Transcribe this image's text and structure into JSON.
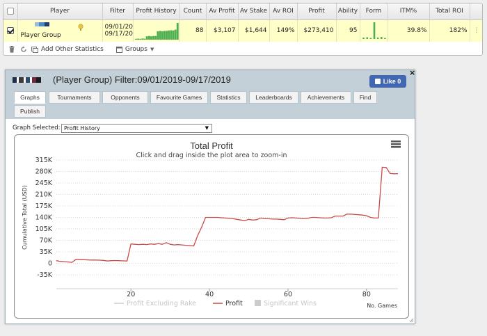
{
  "grid": {
    "headers": [
      "Player",
      "Filter",
      "Profit History",
      "Count",
      "Av Profit",
      "Av Stake",
      "Av ROI",
      "Profit",
      "Ability",
      "Form",
      "ITM%",
      "Total ROI"
    ],
    "row": {
      "checked": true,
      "player": "Player Group",
      "filter_line1": "09/01/20",
      "filter_line2": "09/17/20",
      "count": "88",
      "av_profit": "$3,107",
      "av_stake": "$1,644",
      "av_roi": "149%",
      "profit": "$273,410",
      "ability": "95",
      "itm": "39.8%",
      "total_roi": "182%"
    },
    "profit_history_spark": [
      0.05,
      0.06,
      0.05,
      0.07,
      0.06,
      0.2,
      0.22,
      0.2,
      0.22,
      0.22,
      0.5,
      0.52,
      0.5,
      0.52,
      0.53,
      0.55,
      0.56,
      0.55,
      0.6,
      1.0
    ],
    "form_bars": [
      0.08,
      0.1,
      0.06,
      1.0,
      0.08,
      0.12,
      0.06
    ]
  },
  "toolbar": {
    "add_stats": "Add Other Statistics",
    "groups": "Groups"
  },
  "window": {
    "title": "(Player Group) Filter:09/01/2019-09/17/2019",
    "like_label": "Like 0",
    "close": "×",
    "tabs": [
      "Graphs",
      "Tournaments",
      "Opponents",
      "Favourite Games",
      "Statistics",
      "Leaderboards",
      "Achievements",
      "Find",
      "Publish"
    ],
    "active_tab": "Graphs",
    "graph_selected_label": "Graph Selected:",
    "graph_selected_value": "Profit History"
  },
  "chart_data": {
    "type": "line",
    "title": "Total Profit",
    "subtitle": "Click and drag inside the plot area to zoom-in",
    "ylabel": "Cumulative Total (USD)",
    "xlabel": "No. Games",
    "ylim": [
      -35000,
      315000
    ],
    "xlim": [
      1,
      88
    ],
    "yticks": [
      -35000,
      0,
      35000,
      70000,
      105000,
      140000,
      175000,
      210000,
      245000,
      280000,
      315000
    ],
    "ytick_labels": [
      "-35K",
      "0",
      "35K",
      "70K",
      "105K",
      "140K",
      "175K",
      "210K",
      "245K",
      "280K",
      "315K"
    ],
    "xticks": [
      20,
      40,
      60,
      80
    ],
    "grid": true,
    "legend_position": "bottom-center",
    "color_profit": "#c94a4a",
    "legend": [
      {
        "name": "Profit Excluding Rake",
        "state": "hidden"
      },
      {
        "name": "Profit",
        "state": "visible"
      },
      {
        "name": "Significant Wins",
        "state": "hidden"
      }
    ],
    "series": [
      {
        "name": "Profit",
        "x": [
          1,
          2,
          3,
          4,
          5,
          6,
          7,
          8,
          9,
          10,
          11,
          12,
          13,
          14,
          15,
          16,
          17,
          18,
          19,
          20,
          21,
          22,
          23,
          24,
          25,
          26,
          27,
          28,
          29,
          30,
          31,
          32,
          33,
          34,
          35,
          36,
          37,
          38,
          39,
          40,
          41,
          42,
          43,
          44,
          45,
          46,
          47,
          48,
          49,
          50,
          51,
          52,
          53,
          54,
          55,
          56,
          57,
          58,
          59,
          60,
          61,
          62,
          63,
          64,
          65,
          66,
          67,
          68,
          69,
          70,
          71,
          72,
          73,
          74,
          75,
          76,
          77,
          78,
          79,
          80,
          81,
          82,
          83,
          84,
          85,
          86,
          87,
          88
        ],
        "values": [
          8000,
          6000,
          5000,
          4000,
          3000,
          12000,
          11000,
          11000,
          10500,
          10000,
          10000,
          9500,
          9000,
          7000,
          8000,
          8500,
          8000,
          7500,
          7000,
          59000,
          58000,
          57000,
          58000,
          57000,
          59000,
          58000,
          60000,
          58000,
          63000,
          58000,
          56000,
          57000,
          56000,
          55000,
          54000,
          53000,
          85000,
          110000,
          140000,
          140000,
          140000,
          140000,
          139000,
          138000,
          137000,
          136000,
          134000,
          132000,
          130000,
          134000,
          132000,
          133000,
          138000,
          136000,
          136000,
          135000,
          135000,
          134000,
          133000,
          138000,
          139000,
          138000,
          137000,
          136000,
          137000,
          140000,
          140000,
          139000,
          138000,
          138000,
          139000,
          144000,
          144000,
          144000,
          150000,
          150000,
          149000,
          148000,
          147000,
          145000,
          140000,
          138000,
          138000,
          293000,
          292000,
          274000,
          273000,
          273410
        ]
      }
    ]
  }
}
